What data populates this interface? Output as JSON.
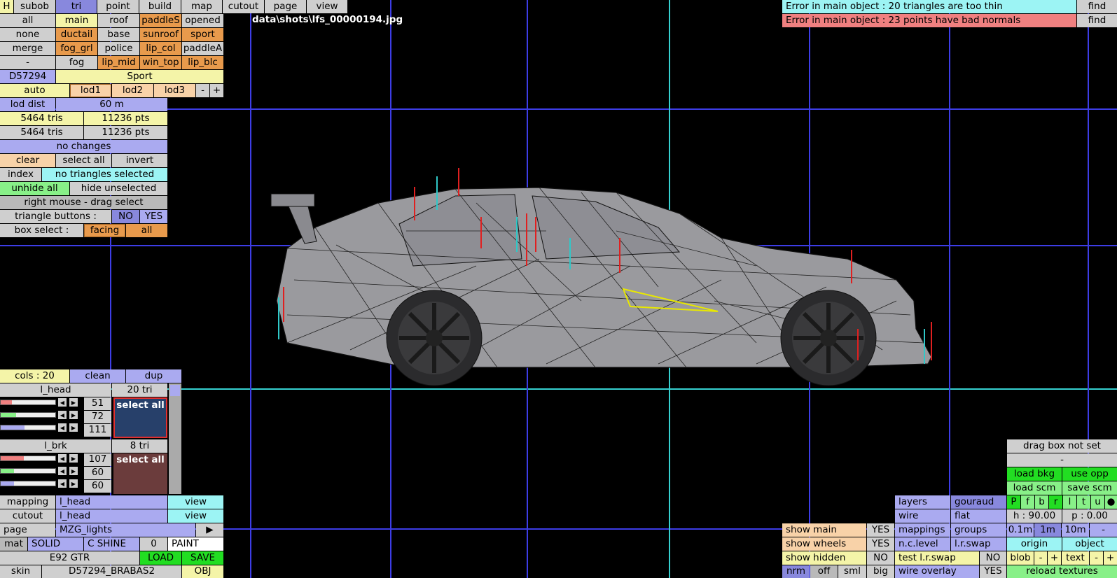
{
  "top_menu": {
    "h": "H",
    "subob": "subob",
    "tri": "tri",
    "point": "point",
    "build": "build",
    "map": "map",
    "cutout": "cutout",
    "page": "page",
    "view": "view"
  },
  "path": "data\\shots\\lfs_00000194.jpg",
  "left_grid": [
    [
      "all",
      "main",
      "roof",
      "paddleS",
      "opened"
    ],
    [
      "none",
      "ductail",
      "base",
      "sunroof",
      "sport"
    ],
    [
      "merge",
      "fog_grl",
      "police",
      "lip_col",
      "paddleA"
    ],
    [
      "-",
      "fog",
      "lip_mid",
      "win_top",
      "lip_blc"
    ]
  ],
  "object_id": "D57294",
  "object_name": "Sport",
  "lod": {
    "auto": "auto",
    "lod1": "lod1",
    "lod2": "lod2",
    "lod3": "lod3",
    "minus": "-",
    "plus": "+",
    "dist_label": "lod dist",
    "dist_value": "60 m"
  },
  "stats": {
    "tris1": "5464 tris",
    "pts1": "11236 pts",
    "tris2": "5464 tris",
    "pts2": "11236 pts",
    "changes": "no changes"
  },
  "selection": {
    "clear": "clear",
    "select_all": "select all",
    "invert": "invert",
    "index": "index",
    "status": "no triangles selected",
    "unhide": "unhide all",
    "hide_unsel": "hide unselected",
    "hint": "right mouse - drag select",
    "tri_buttons": "triangle buttons :",
    "no": "NO",
    "yes": "YES",
    "box_select": "box select :",
    "facing": "facing",
    "all": "all"
  },
  "errors": [
    {
      "text": "Error in main object : 20 triangles are too thin",
      "find": "find"
    },
    {
      "text": "Error in main object : 23 points have bad normals",
      "find": "find"
    }
  ],
  "colors_panel": {
    "cols": "cols : 20",
    "clean": "clean",
    "dup": "dup",
    "c1": {
      "name": "l_head",
      "tri": "20 tri",
      "r": "51",
      "g": "72",
      "b": "111",
      "btn": "select all",
      "swatch": "#27406a",
      "r_frac": 0.2,
      "g_frac": 0.28,
      "b_frac": 0.44
    },
    "c2": {
      "name": "l_brk",
      "tri": "8 tri",
      "r": "107",
      "g": "60",
      "b": "60",
      "btn": "select all",
      "swatch": "#6b3c3c",
      "r_frac": 0.42,
      "g_frac": 0.24,
      "b_frac": 0.24
    }
  },
  "bottom_left": {
    "mapping": "mapping",
    "mapping_val": "l_head",
    "view1": "view",
    "cutout": "cutout",
    "cutout_val": "l_head",
    "view2": "view",
    "page": "page",
    "page_val": "MZG_lights",
    "arrow": "▶",
    "mat": "mat",
    "solid": "SOLID",
    "cshine": "C SHINE",
    "zero": "0",
    "paint": "PAINT",
    "car": "E92 GTR",
    "load": "LOAD",
    "save": "SAVE",
    "skin": "skin",
    "skin_val": "D57294_BRABAS2",
    "obj": "OBJ"
  },
  "bottom_mid": {
    "show_main": "show main",
    "yes1": "YES",
    "show_wheels": "show wheels",
    "yes2": "YES",
    "show_hidden": "show hidden",
    "no1": "NO",
    "nrm": "nrm",
    "off": "off",
    "sml": "sml",
    "big": "big"
  },
  "bottom_right": {
    "layers": "layers",
    "gouraud": "gouraud",
    "wire": "wire",
    "flat": "flat",
    "mappings": "mappings",
    "groups": "groups",
    "nclevel": "n.c.level",
    "lrswap": "l.r.swap",
    "test_lr": "test l.r.swap",
    "no2": "NO",
    "wire_overlay": "wire overlay",
    "yes3": "YES",
    "drag_box": "drag box not set",
    "dash": "-",
    "load_bkg": "load bkg",
    "use_opp": "use opp",
    "load_scm": "load scm",
    "save_scm": "save scm",
    "views": [
      "P",
      "f",
      "b",
      "r",
      "l",
      "t",
      "u",
      "●"
    ],
    "h": "h : 90.00",
    "p": "p : 0.00",
    "s1": "0.1m",
    "s2": "1m",
    "s3": "10m",
    "s4": "-",
    "blob": "blob",
    "bm": "-",
    "bp": "+",
    "text": "text",
    "tm": "-",
    "tp": "+",
    "reload": "reload textures",
    "origin": "origin",
    "object": "object"
  }
}
